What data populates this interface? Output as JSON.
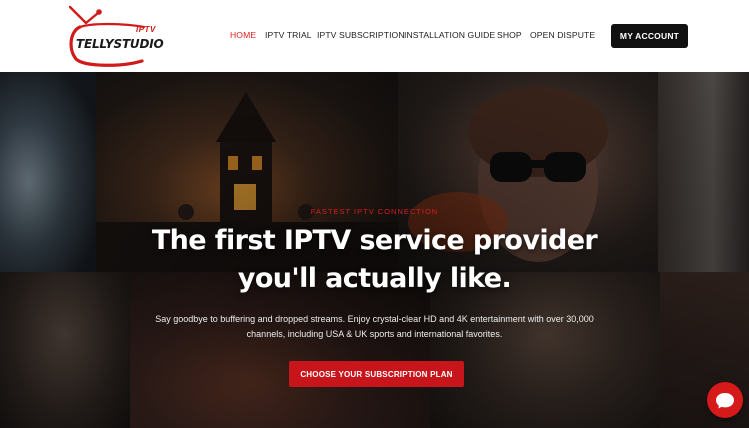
{
  "brand": {
    "name": "TELLYSTUDIO",
    "sub": "IPTV"
  },
  "nav": {
    "items": [
      {
        "label": "HOME",
        "active": true
      },
      {
        "label": "IPTV TRIAL"
      },
      {
        "label": "IPTV SUBSCRIPTION"
      },
      {
        "label": "INSTALLATION GUIDE"
      },
      {
        "label": "SHOP"
      },
      {
        "label": "OPEN DISPUTE"
      }
    ],
    "account_label": "MY ACCOUNT"
  },
  "hero": {
    "eyebrow": "FASTEST IPTV CONNECTION",
    "headline_line1": "The first IPTV service provider",
    "headline_line2": "you'll actually like.",
    "subtext_line1": "Say goodbye to buffering and dropped streams. Enjoy crystal-clear HD and 4K entertainment with over 30,000",
    "subtext_line2": "channels, including USA & UK sports and international favorites.",
    "cta_label": "CHOOSE YOUR SUBSCRIPTION PLAN"
  },
  "colors": {
    "accent": "#e02020",
    "cta": "#c8141b",
    "account_button": "#111111"
  },
  "icons": {
    "chat": "chat-bubble-icon",
    "logo": "tv-antenna-icon"
  }
}
